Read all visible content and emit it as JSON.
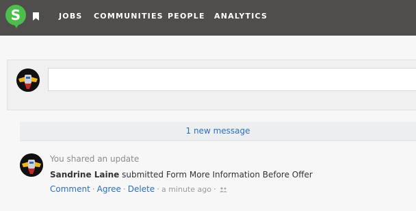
{
  "brand": {
    "logo_letter": "S",
    "color": "#4cbf4b"
  },
  "nav": {
    "items": [
      {
        "label": "JOBS"
      },
      {
        "label": "COMMUNITIES"
      },
      {
        "label": "PEOPLE"
      },
      {
        "label": "ANALYTICS"
      }
    ],
    "background": "#4f4e4d",
    "bookmark_icon": "bookmark-icon"
  },
  "composer": {
    "value": "",
    "placeholder": ""
  },
  "banner": {
    "text": "1 new message"
  },
  "feed": {
    "items": [
      {
        "meta": "You shared an update",
        "actor": "Sandrine Laine",
        "action": " submitted Form More Information Before Offer",
        "actions": {
          "comment": "Comment",
          "agree": "Agree",
          "delete": "Delete",
          "time": "a minute ago"
        },
        "visibility_icon": "people-icon"
      }
    ]
  },
  "colors": {
    "link": "#2a6fc4",
    "muted": "#8c8c8c"
  }
}
